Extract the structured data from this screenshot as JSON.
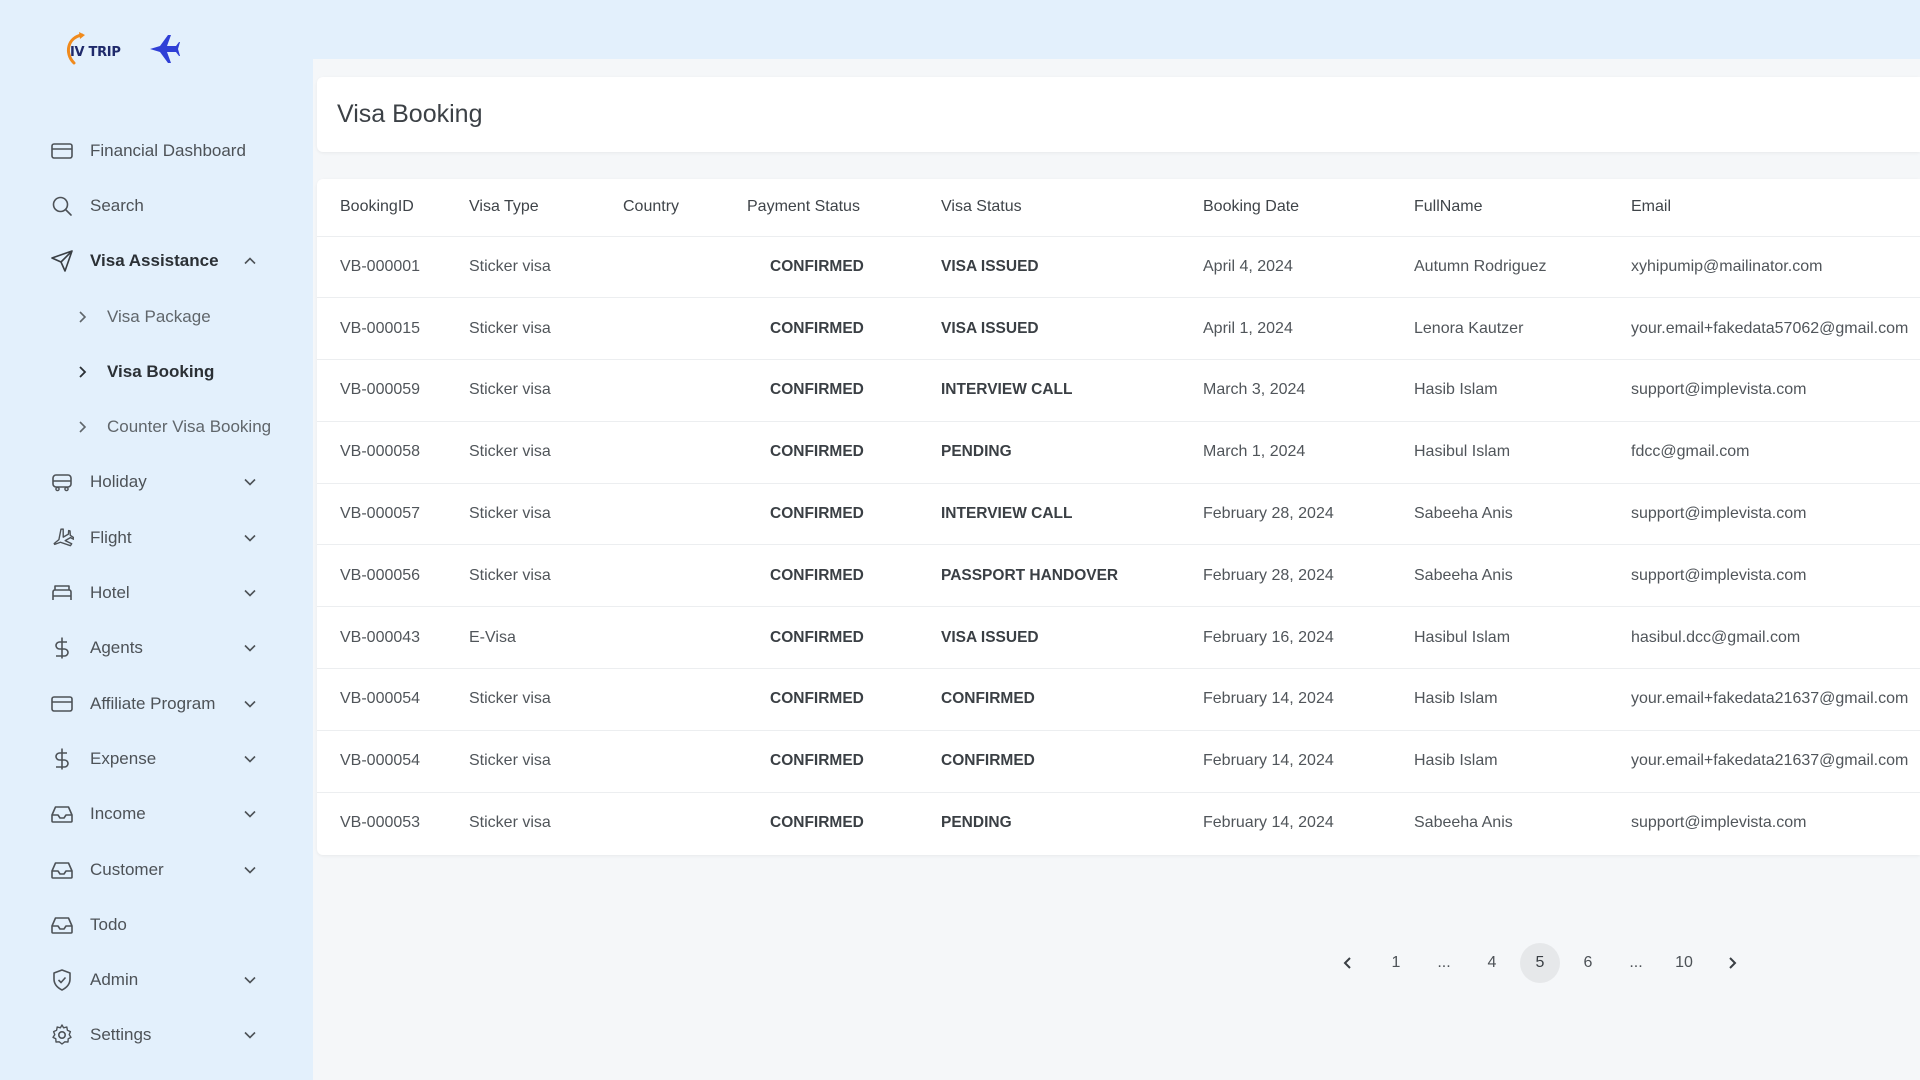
{
  "app": {
    "logo_text": "IV TRIP"
  },
  "sidebar": {
    "items": [
      {
        "label": "Financial Dashboard",
        "icon": "card-icon",
        "expandable": false
      },
      {
        "label": "Search",
        "icon": "search-icon",
        "expandable": false
      },
      {
        "label": "Visa Assistance",
        "icon": "send-icon",
        "expandable": true,
        "expanded": true,
        "children": [
          {
            "label": "Visa Package",
            "active": false
          },
          {
            "label": "Visa Booking",
            "active": true
          },
          {
            "label": "Counter Visa Booking",
            "active": false
          }
        ]
      },
      {
        "label": "Holiday",
        "icon": "bus-icon",
        "expandable": true
      },
      {
        "label": "Flight",
        "icon": "plane-icon",
        "expandable": true
      },
      {
        "label": "Hotel",
        "icon": "bed-icon",
        "expandable": true
      },
      {
        "label": "Agents",
        "icon": "dollar-icon",
        "expandable": true
      },
      {
        "label": "Affiliate Program",
        "icon": "card-icon",
        "expandable": true
      },
      {
        "label": "Expense",
        "icon": "dollar-icon",
        "expandable": true
      },
      {
        "label": "Income",
        "icon": "inbox-icon",
        "expandable": true
      },
      {
        "label": "Customer",
        "icon": "inbox-icon",
        "expandable": true
      },
      {
        "label": "Todo",
        "icon": "inbox-icon",
        "expandable": false
      },
      {
        "label": "Admin",
        "icon": "shield-icon",
        "expandable": true
      },
      {
        "label": "Settings",
        "icon": "gear-icon",
        "expandable": true
      }
    ]
  },
  "page": {
    "title": "Visa Booking"
  },
  "table": {
    "headers": [
      "BookingID",
      "Visa Type",
      "Country",
      "Payment Status",
      "Visa Status",
      "Booking Date",
      "FullName",
      "Email"
    ],
    "rows": [
      [
        "VB-000001",
        "Sticker visa",
        "",
        "CONFIRMED",
        "VISA ISSUED",
        "April 4, 2024",
        "Autumn Rodriguez",
        "xyhipumip@mailinator.com"
      ],
      [
        "VB-000015",
        "Sticker visa",
        "",
        "CONFIRMED",
        "VISA ISSUED",
        "April 1, 2024",
        "Lenora Kautzer",
        "your.email+fakedata57062@gmail.com"
      ],
      [
        "VB-000059",
        "Sticker visa",
        "",
        "CONFIRMED",
        "INTERVIEW CALL",
        "March 3, 2024",
        "Hasib Islam",
        "support@implevista.com"
      ],
      [
        "VB-000058",
        "Sticker visa",
        "",
        "CONFIRMED",
        "PENDING",
        "March 1, 2024",
        "Hasibul Islam",
        "fdcc@gmail.com"
      ],
      [
        "VB-000057",
        "Sticker visa",
        "",
        "CONFIRMED",
        "INTERVIEW CALL",
        "February 28, 2024",
        "Sabeeha Anis",
        "support@implevista.com"
      ],
      [
        "VB-000056",
        "Sticker visa",
        "",
        "CONFIRMED",
        "PASSPORT HANDOVER",
        "February 28, 2024",
        "Sabeeha Anis",
        "support@implevista.com"
      ],
      [
        "VB-000043",
        "E-Visa",
        "",
        "CONFIRMED",
        "VISA ISSUED",
        "February 16, 2024",
        "Hasibul Islam",
        "hasibul.dcc@gmail.com"
      ],
      [
        "VB-000054",
        "Sticker visa",
        "",
        "CONFIRMED",
        "CONFIRMED",
        "February 14, 2024",
        "Hasib Islam",
        "your.email+fakedata21637@gmail.com"
      ],
      [
        "VB-000054",
        "Sticker visa",
        "",
        "CONFIRMED",
        "CONFIRMED",
        "February 14, 2024",
        "Hasib Islam",
        "your.email+fakedata21637@gmail.com"
      ],
      [
        "VB-000053",
        "Sticker visa",
        "",
        "CONFIRMED",
        "PENDING",
        "February 14, 2024",
        "Sabeeha Anis",
        "support@implevista.com"
      ]
    ]
  },
  "pagination": {
    "pages": [
      "1",
      "...",
      "4",
      "5",
      "6",
      "...",
      "10"
    ],
    "current": "5"
  },
  "colors": {
    "sidebar_bg": "#e3f0fc",
    "logo_plane": "#2f3fd6",
    "logo_swoosh": "#f08a1c"
  }
}
